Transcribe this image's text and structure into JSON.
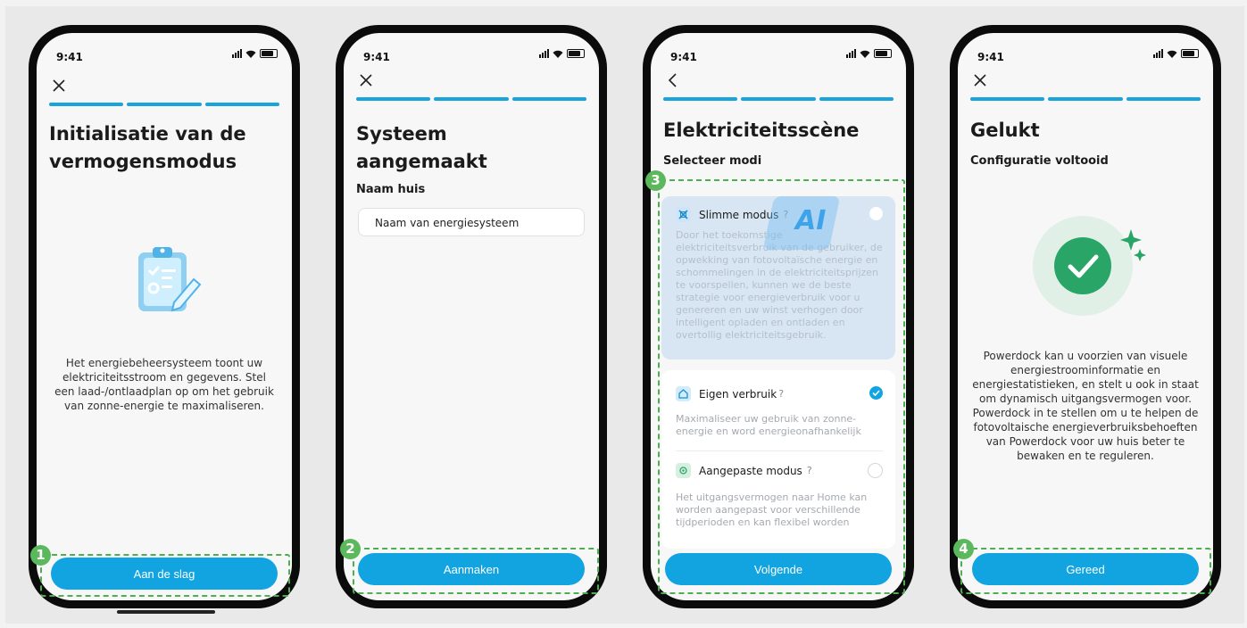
{
  "status": {
    "time": "9:41"
  },
  "screen1": {
    "title": "Initialisatie van de vermogensmodus",
    "description": "Het energiebeheersysteem toont uw elektriciteitsstroom en gegevens. Stel een laad-/ontlaadplan op om het gebruik van zonne-energie te maximaliseren.",
    "button": "Aan de slag",
    "step": "1"
  },
  "screen2": {
    "title": "Systeem aangemaakt",
    "field_label": "Naam huis",
    "input_placeholder": "Naam van energiesysteem",
    "button": "Aanmaken",
    "step": "2"
  },
  "screen3": {
    "title": "Elektriciteitsscène",
    "subtitle": "Selecteer modi",
    "modes": [
      {
        "title": "Slimme modus",
        "desc": "Door het toekomstige elektriciteitsverbruik van de gebruiker, de opwekking van fotovoltaïsche energie en schommelingen in de elektriciteitsprijzen te voorspellen, kunnen we de beste strategie voor energieverbruik voor u genereren en uw winst verhogen door intelligent opladen en ontladen en overtollig elektriciteitsgebruik."
      },
      {
        "title": "Eigen verbruik",
        "desc": "Maximaliseer uw gebruik van zonne-energie en word energieonafhankelijk"
      },
      {
        "title": "Aangepaste modus",
        "desc": "Het uitgangsvermogen naar Home kan worden aangepast voor verschillende tijdperioden en kan flexibel worden"
      }
    ],
    "help_symbol": "?",
    "ai_badge": "AI",
    "button": "Volgende",
    "step": "3"
  },
  "screen4": {
    "title": "Gelukt",
    "subtitle": "Configuratie voltooid",
    "description": "Powerdock kan u voorzien van visuele energiestroominformatie en energiestatistieken, en stelt u ook in staat om dynamisch uitgangsvermogen voor. Powerdock in te stellen om u te helpen de fotovoltaische energieverbruiksbehoeften van Powerdock voor uw huis beter te bewaken en te reguleren.",
    "button": "Gereed",
    "step": "4"
  },
  "colors": {
    "accent": "#11a4e1",
    "highlight": "#5cb85c",
    "success": "#2aa568"
  }
}
